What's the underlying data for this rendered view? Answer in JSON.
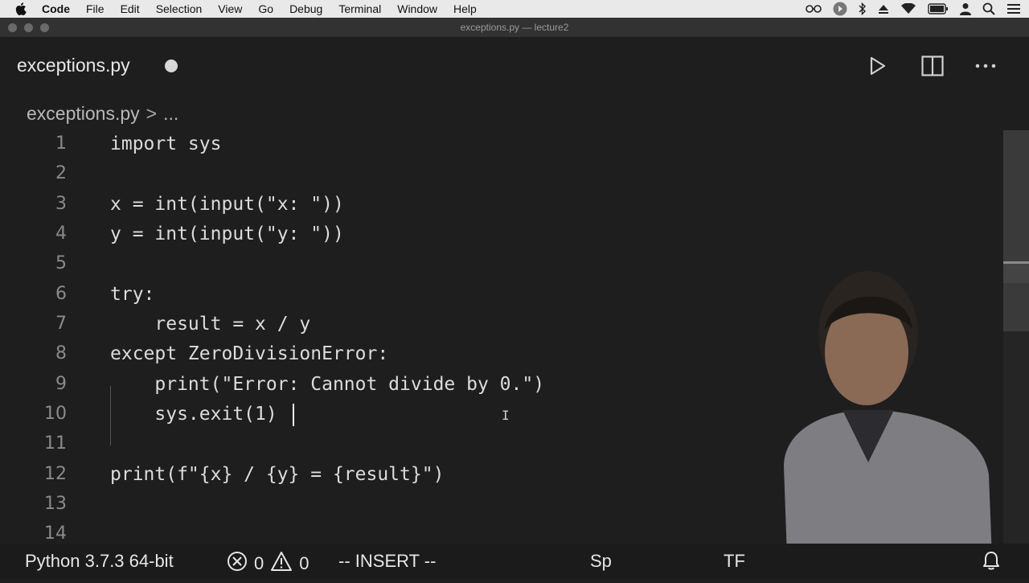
{
  "menubar": {
    "apple": "",
    "app_name": "Code",
    "items": [
      "File",
      "Edit",
      "Selection",
      "View",
      "Go",
      "Debug",
      "Terminal",
      "Window",
      "Help"
    ],
    "status_icons": [
      "glasses-icon",
      "circle-arrow-icon",
      "bluetooth-icon",
      "eject-icon",
      "wifi-icon",
      "battery-icon",
      "user-icon",
      "search-icon",
      "list-icon"
    ]
  },
  "window": {
    "title": "exceptions.py — lecture2"
  },
  "tab": {
    "filename": "exceptions.py",
    "unsaved": true
  },
  "actions": [
    "run-icon",
    "split-editor-icon",
    "more-icon"
  ],
  "breadcrumb": {
    "file": "exceptions.py",
    "separator": ">",
    "more": "..."
  },
  "code": {
    "lines": [
      "import sys",
      "",
      "x = int(input(\"x: \"))",
      "y = int(input(\"y: \"))",
      "",
      "try:",
      "    result = x / y",
      "except ZeroDivisionError:",
      "    print(\"Error: Cannot divide by 0.\")",
      "    sys.exit(1)",
      "",
      "print(f\"{x} / {y} = {result}\")",
      "",
      ""
    ],
    "line_numbers": [
      "1",
      "2",
      "3",
      "4",
      "5",
      "6",
      "7",
      "8",
      "9",
      "10",
      "11",
      "12",
      "13",
      "14"
    ],
    "cursor": {
      "line": 10,
      "col": 15
    }
  },
  "statusbar": {
    "interpreter": "Python 3.7.3 64-bit",
    "errors": "0",
    "warnings": "0",
    "mode": "-- INSERT --",
    "spaces_partial": "Sp",
    "encoding_partial": "TF",
    "bell": "bell-icon"
  },
  "colors": {
    "editor_bg": "#1e1e1e",
    "menubar_bg": "#e9e9e9",
    "text": "#dcdcdc"
  }
}
